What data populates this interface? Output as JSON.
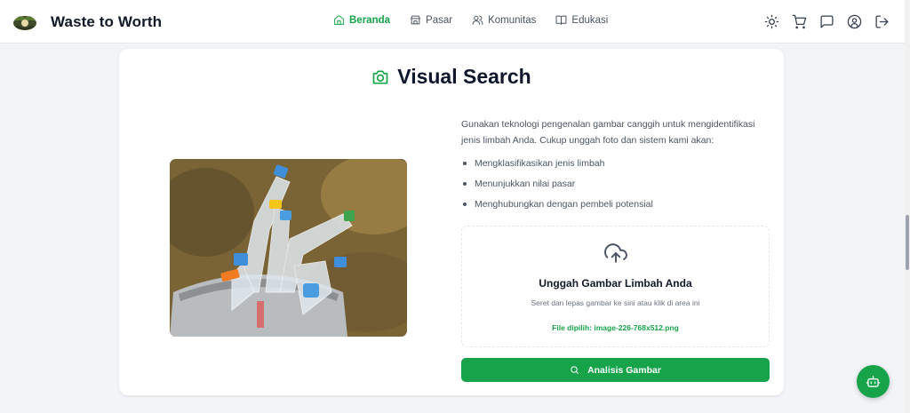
{
  "header": {
    "brand": "Waste to Worth",
    "nav": [
      {
        "label": "Beranda",
        "icon": "home-icon",
        "active": true
      },
      {
        "label": "Pasar",
        "icon": "store-icon",
        "active": false
      },
      {
        "label": "Komunitas",
        "icon": "users-icon",
        "active": false
      },
      {
        "label": "Edukasi",
        "icon": "book-icon",
        "active": false
      }
    ],
    "actions": [
      "sun-icon",
      "cart-icon",
      "message-icon",
      "user-circle-icon",
      "logout-icon"
    ]
  },
  "main": {
    "title": "Visual Search",
    "title_icon": "camera-icon",
    "description": "Gunakan teknologi pengenalan gambar canggih untuk mengidentifikasi jenis limbah Anda. Cukup unggah foto dan sistem kami akan:",
    "bullets": [
      "Mengklasifikasikan jenis limbah",
      "Menunjukkan nilai pasar",
      "Menghubungkan dengan pembeli potensial"
    ],
    "dropzone": {
      "icon": "cloud-upload-icon",
      "title": "Unggah Gambar Limbah Anda",
      "subtitle": "Seret dan lepas gambar ke sini atau klik di area ini",
      "selected_file": "File dipilih: image-226-768x512.png"
    },
    "analyze_button": "Analisis Gambar"
  },
  "fab_icon": "bot-icon",
  "colors": {
    "accent": "#16a34a",
    "page_bg": "#f2f4f7",
    "card_bg": "#ffffff",
    "text_dark": "#111827",
    "text_muted": "#4b5563"
  }
}
